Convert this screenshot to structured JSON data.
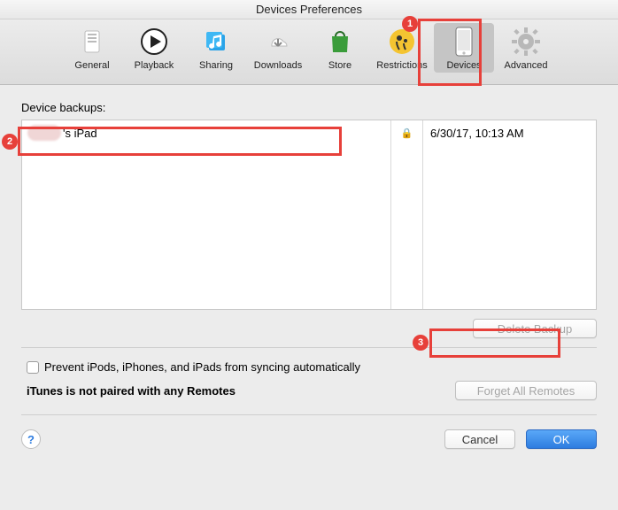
{
  "window": {
    "title": "Devices Preferences"
  },
  "toolbar": {
    "items": [
      {
        "label": "General"
      },
      {
        "label": "Playback"
      },
      {
        "label": "Sharing"
      },
      {
        "label": "Downloads"
      },
      {
        "label": "Store"
      },
      {
        "label": "Restrictions"
      },
      {
        "label": "Devices"
      },
      {
        "label": "Advanced"
      }
    ],
    "selected_index": 6
  },
  "backups": {
    "heading": "Device backups:",
    "rows": [
      {
        "name": "'s iPad",
        "locked": true,
        "date": "6/30/17, 10:13 AM"
      }
    ]
  },
  "buttons": {
    "delete_backup": "Delete Backup",
    "forget_remotes": "Forget All Remotes",
    "cancel": "Cancel",
    "ok": "OK"
  },
  "checks": {
    "prevent_sync": "Prevent iPods, iPhones, and iPads from syncing automatically"
  },
  "remotes": {
    "status": "iTunes is not paired with any Remotes"
  },
  "annotations": {
    "n1": "1",
    "n2": "2",
    "n3": "3"
  },
  "help": {
    "glyph": "?"
  },
  "lock_glyph": "🔒"
}
